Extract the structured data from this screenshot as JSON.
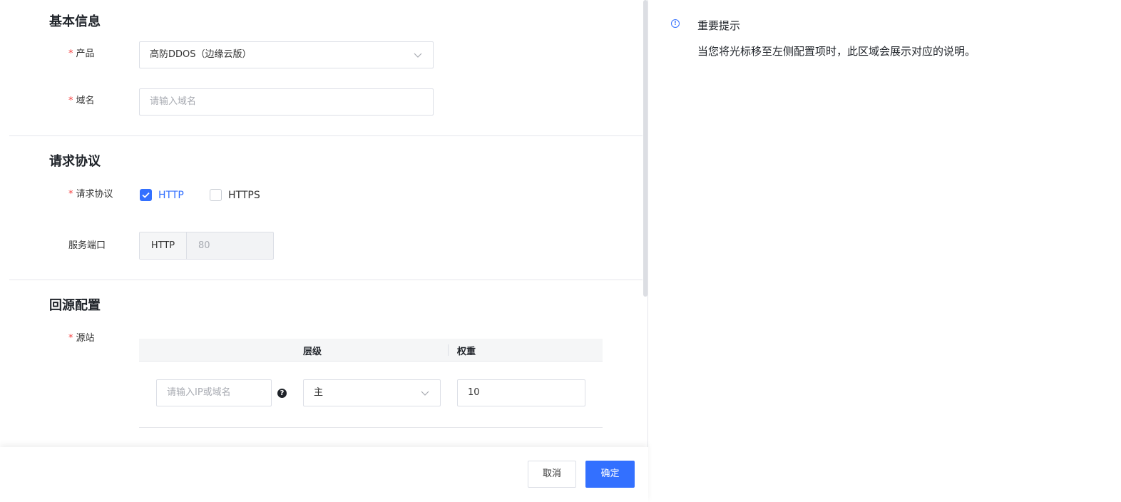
{
  "sections": {
    "basic_info": "基本信息",
    "protocol": "请求协议",
    "origin": "回源配置"
  },
  "fields": {
    "product": {
      "required": "*",
      "label": "产品",
      "value": "高防DDOS（边缘云版）"
    },
    "domain": {
      "required": "*",
      "label": "域名",
      "placeholder": "请输入域名"
    },
    "protocol": {
      "required": "*",
      "label": "请求协议",
      "options": [
        {
          "label": "HTTP",
          "checked": true
        },
        {
          "label": "HTTPS",
          "checked": false
        }
      ]
    },
    "service_port": {
      "label": "服务端口",
      "prefix": "HTTP",
      "value": "80"
    },
    "origin_site": {
      "required": "*",
      "label": "源站",
      "columns": [
        "层级",
        "权重"
      ],
      "row": {
        "address_placeholder": "请输入IP或域名",
        "help_icon": "?",
        "level": "主",
        "weight": "10"
      }
    }
  },
  "footer": {
    "cancel": "取消",
    "confirm": "确定"
  },
  "tip": {
    "icon": "!",
    "title": "重要提示",
    "description": "当您将光标移至左侧配置项时，此区域会展示对应的说明。"
  },
  "colors": {
    "accent": "#3370ff",
    "required": "#f53f3f",
    "border": "#dcdfe6",
    "divider": "#e5e6eb"
  }
}
